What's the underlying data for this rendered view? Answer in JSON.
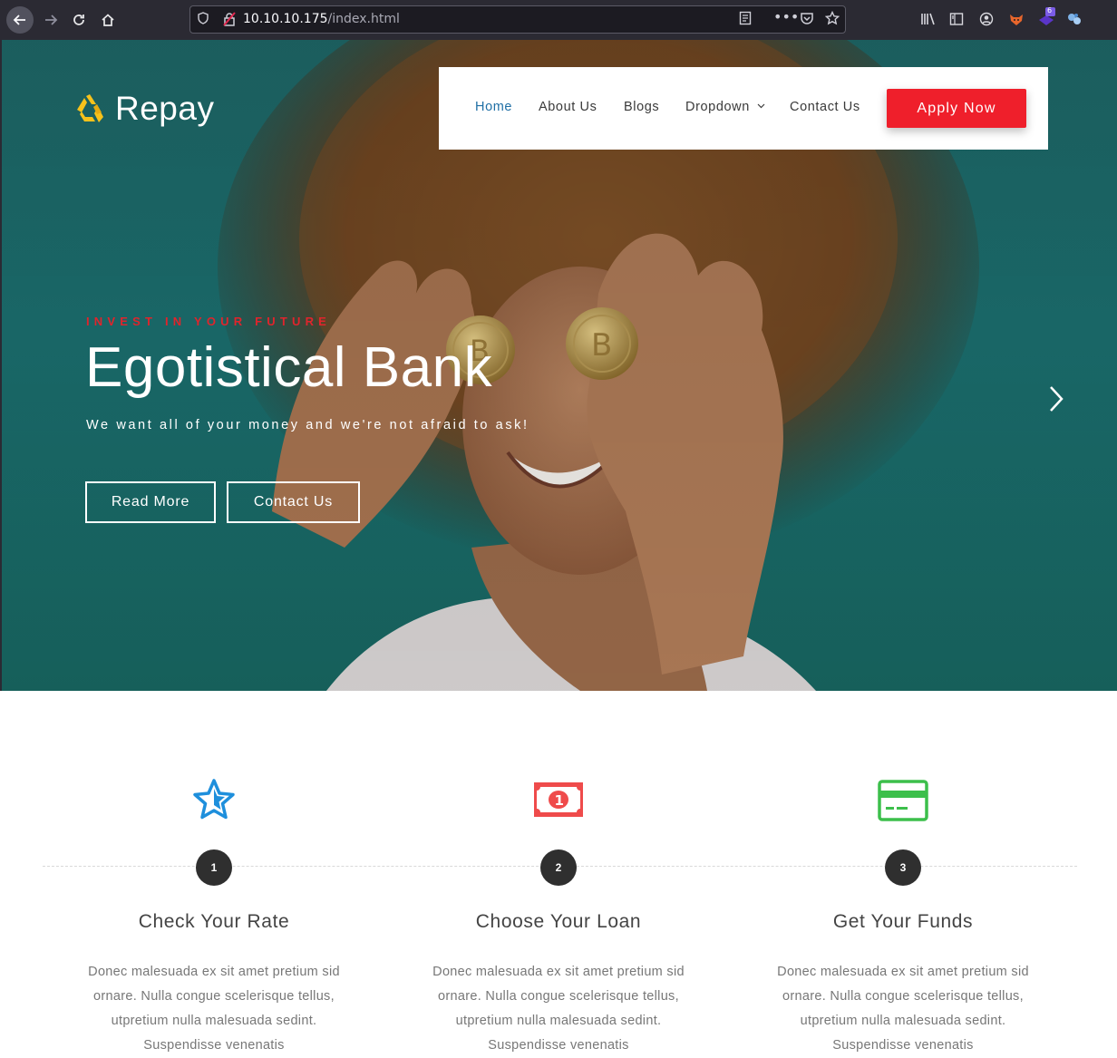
{
  "browser": {
    "url_host": "10.10.10.175",
    "url_path": "/index.html",
    "extension_badge": "6"
  },
  "site": {
    "logo_text": "Repay",
    "nav": {
      "items": [
        "Home",
        "About Us",
        "Blogs",
        "Dropdown",
        "Contact Us"
      ],
      "active": "Home",
      "cta": "Apply Now"
    },
    "hero": {
      "eyebrow": "INVEST IN YOUR FUTURE",
      "title": "Egotistical Bank",
      "subtitle": "We want all of your money and we're not afraid to ask!",
      "primary_button": "Read More",
      "secondary_button": "Contact Us"
    },
    "steps": [
      {
        "number": "1",
        "icon": "star-icon",
        "icon_color": "#1e8fdc",
        "title": "Check Your Rate",
        "body": [
          "Donec malesuada ex sit amet pretium sid",
          "ornare. Nulla congue scelerisque tellus,",
          "utpretium nulla malesuada sedint.",
          "Suspendisse venenatis"
        ]
      },
      {
        "number": "2",
        "icon": "money-bill-icon",
        "icon_color": "#ef4b4b",
        "title": "Choose Your Loan",
        "body": [
          "Donec malesuada ex sit amet pretium sid",
          "ornare. Nulla congue scelerisque tellus,",
          "utpretium nulla malesuada sedint.",
          "Suspendisse venenatis"
        ]
      },
      {
        "number": "3",
        "icon": "credit-card-icon",
        "icon_color": "#3cbf4b",
        "title": "Get Your Funds",
        "body": [
          "Donec malesuada ex sit amet pretium sid",
          "ornare. Nulla congue scelerisque tellus,",
          "utpretium nulla malesuada sedint.",
          "Suspendisse venenatis"
        ]
      }
    ]
  },
  "colors": {
    "accent_red": "#ef1f2b",
    "hero_teal": "#1b7070",
    "active_nav": "#1f6fa5"
  }
}
